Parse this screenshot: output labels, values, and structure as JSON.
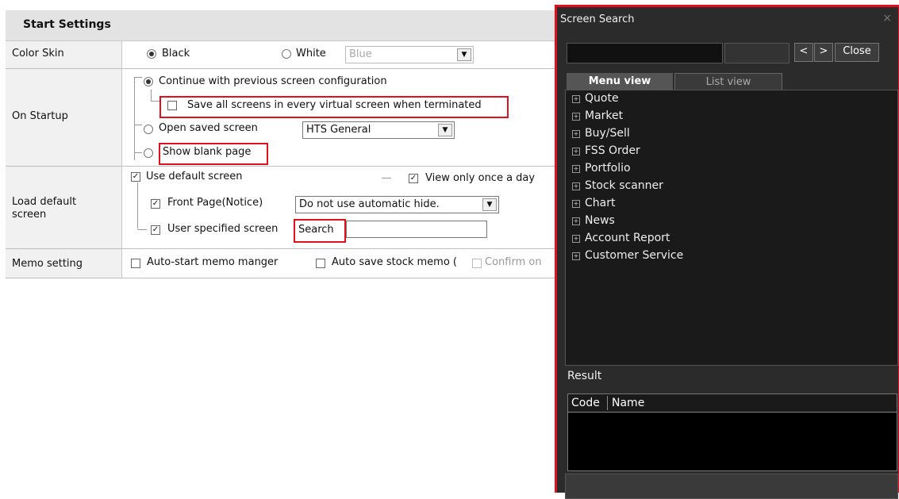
{
  "settings": {
    "title": "Start Settings",
    "color_skin": {
      "label": "Color Skin",
      "black": "Black",
      "white": "White",
      "color_value": "Blue"
    },
    "on_startup": {
      "label": "On Startup",
      "continue": "Continue with previous screen configuration",
      "save_all": "Save all screens in every virtual screen when terminated",
      "open_saved": "Open saved screen",
      "saved_value": "HTS General",
      "blank": "Show blank page"
    },
    "load_default": {
      "label_line1": "Load default",
      "label_line2": "screen",
      "use_default": "Use default screen",
      "view_once": "View only once a day",
      "front_page": "Front Page(Notice)",
      "front_value": "Do not use automatic hide.",
      "user_specified": "User specified screen",
      "search_btn": "Search"
    },
    "memo": {
      "label": "Memo setting",
      "auto_start": "Auto-start memo manger",
      "auto_save": "Auto save stock memo (",
      "confirm": "Confirm on"
    }
  },
  "screen_search": {
    "title": "Screen Search",
    "close_x": "×",
    "prev": "<",
    "next": ">",
    "close": "Close",
    "tabs": [
      "Menu view",
      "List view"
    ],
    "tree": [
      "Quote",
      "Market",
      "Buy/Sell",
      "FSS Order",
      "Portfolio",
      "Stock scanner",
      "Chart",
      "News",
      "Account Report",
      "Customer Service"
    ],
    "result_label": "Result",
    "columns": [
      "Code",
      "Name"
    ]
  }
}
